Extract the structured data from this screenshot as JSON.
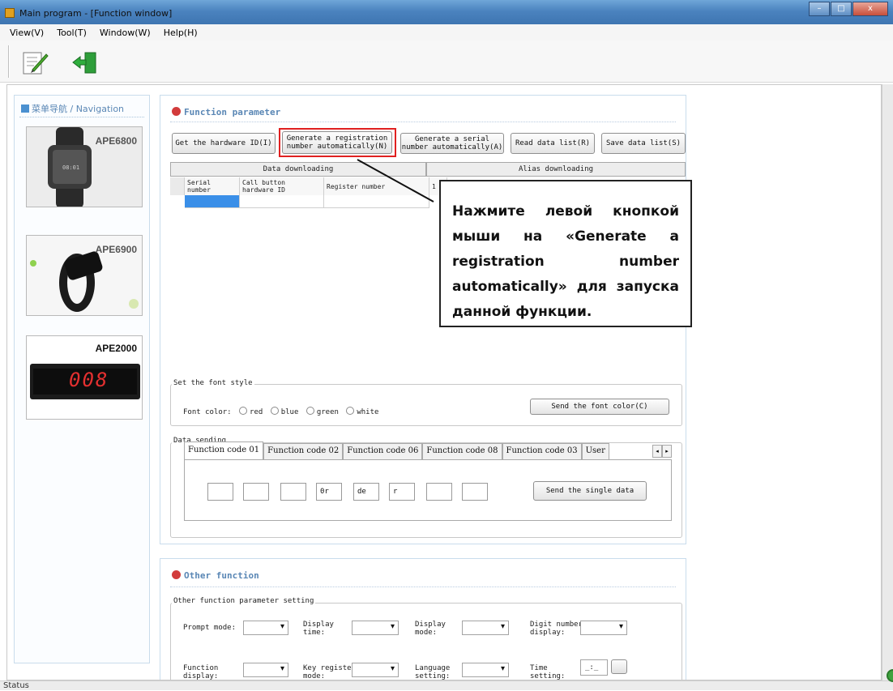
{
  "window": {
    "title": "Main program - [Function window]",
    "btn_min": "–",
    "btn_max": "□",
    "btn_close": "x"
  },
  "menu": [
    "View(V)",
    "Tool(T)",
    "Window(W)",
    "Help(H)"
  ],
  "toolbar": {
    "icons": [
      "edit-icon",
      "exit-icon"
    ]
  },
  "nav": {
    "title": "菜单导航 / Navigation",
    "products": [
      "APE6800",
      "APE6900",
      "APE2000"
    ],
    "watch_time": "08:01",
    "display_digits": "008"
  },
  "function_panel": {
    "title": "Function parameter",
    "buttons": {
      "get_hw_id": "Get the hardware ID(I)",
      "gen_reg_1": "Generate a registration",
      "gen_reg_2": "number automatically(N)",
      "gen_serial_1": "Generate a serial",
      "gen_serial_2": "number automatically(A)",
      "read_list": "Read data list(R)",
      "save_list": "Save data list(S)"
    },
    "grid": {
      "group_data": "Data downloading",
      "group_alias": "Alias downloading",
      "col_serial_1": "Serial",
      "col_serial_2": "number",
      "col_callbtn_1": "Call button",
      "col_callbtn_2": "hardware ID",
      "col_register": "Register number",
      "col_alias_1": "1"
    },
    "font_style": {
      "group": "Set the font style",
      "label": "Font color:",
      "options": [
        "red",
        "blue",
        "green",
        "white"
      ],
      "send_btn": "Send the font color(C)"
    },
    "data_sending": {
      "group": "Data sending",
      "tabs": [
        "Function code 01",
        "Function code 02",
        "Function code 06",
        "Function code 08",
        "Function code 03",
        "User"
      ],
      "inputs": [
        "",
        "",
        "",
        "0r",
        "de",
        "r",
        "",
        ""
      ],
      "send_btn": "Send the single data"
    }
  },
  "callout": {
    "text": "Нажмите левой кнопкой мыши на «Generate a registration number automatically» для запуска данной функции."
  },
  "other_panel": {
    "title": "Other function",
    "group": "Other function parameter setting",
    "row1": {
      "prompt_mode": "Prompt mode:",
      "display_time_1": "Display",
      "display_time_2": "time:",
      "display_mode_1": "Display",
      "display_mode_2": "mode:",
      "digit_number_1": "Digit number",
      "digit_number_2": "display:"
    },
    "row2": {
      "function_display_1": "Function",
      "function_display_2": "display:",
      "key_register_1": "Key register",
      "key_register_2": "mode:",
      "language_1": "Language",
      "language_2": "setting:",
      "time_1": "Time",
      "time_2": "setting:",
      "time_value": "_:_"
    }
  },
  "status": {
    "text": "Status"
  },
  "colors": {
    "accent": "#5a87b5",
    "highlight": "#e02020",
    "title_bar": "#4b83bf"
  }
}
